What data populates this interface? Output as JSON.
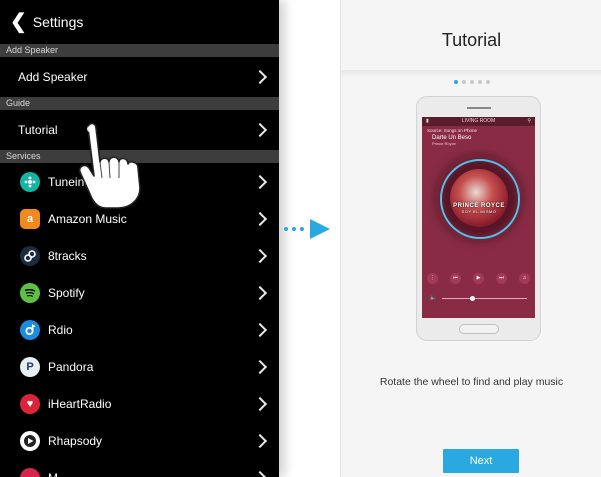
{
  "settings": {
    "title": "Settings",
    "sections": {
      "add_speaker": "Add Speaker",
      "guide": "Guide",
      "services": "Services"
    },
    "add_speaker_item": "Add Speaker",
    "tutorial_item": "Tutorial",
    "services": [
      {
        "label": "Tunein Radio",
        "icon": "tunein-icon",
        "color": "#13b6a3"
      },
      {
        "label": "Amazon Music",
        "icon": "amazon-icon",
        "color": "#f08a1c"
      },
      {
        "label": "8tracks",
        "icon": "8tracks-icon",
        "color": "#1b2b40"
      },
      {
        "label": "Spotify",
        "icon": "spotify-icon",
        "color": "#5fc142"
      },
      {
        "label": "Rdio",
        "icon": "rdio-icon",
        "color": "#1b8ce0"
      },
      {
        "label": "Pandora",
        "icon": "pandora-icon",
        "color": "#e9eef4"
      },
      {
        "label": "iHeartRadio",
        "icon": "iheartradio-icon",
        "color": "#d9243a"
      },
      {
        "label": "Rhapsody",
        "icon": "rhapsody-icon",
        "color": "#ffffff"
      },
      {
        "label": "M",
        "icon": "partial-service-icon",
        "color": "#d9244d"
      }
    ]
  },
  "tutorial": {
    "title": "Tutorial",
    "page_dots": 5,
    "active_dot": 0,
    "device_screen": {
      "room": "LIVING ROOM",
      "source": "Source: Songs on Phone",
      "song": "Darte Un Beso",
      "artist": "Prince Royce",
      "album_text": "PRINCE ROYCE",
      "album_sub": "SOY EL MISMO"
    },
    "caption": "Rotate the wheel to find and play music",
    "next_label": "Next"
  },
  "colors": {
    "accent": "#29a9e0",
    "settings_bg": "#000000",
    "section_bg": "#3d3d3d",
    "tutorial_bg": "#f5f5f5"
  }
}
